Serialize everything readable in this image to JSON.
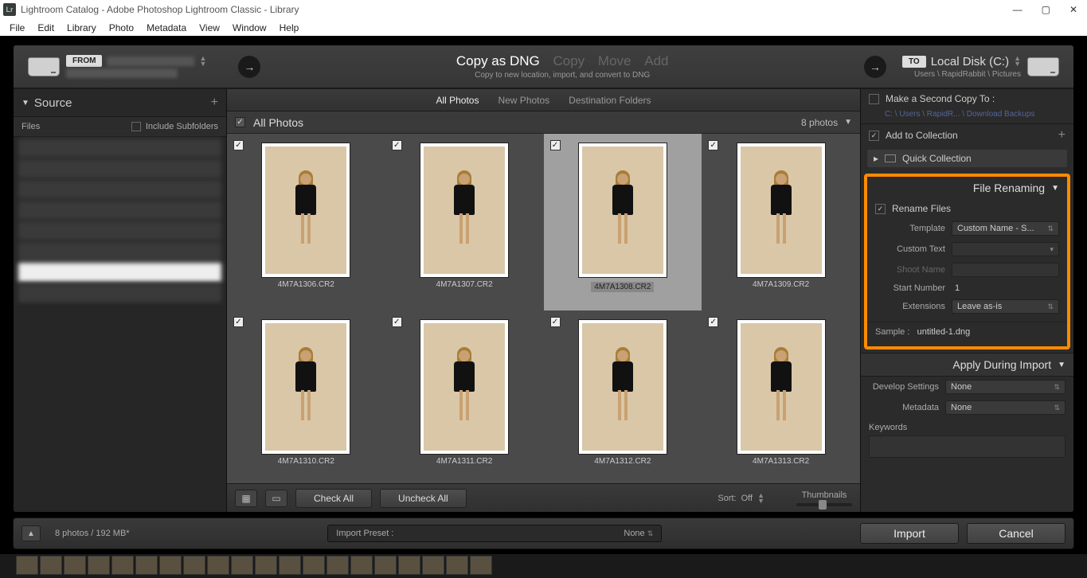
{
  "window": {
    "title": "Lightroom Catalog - Adobe Photoshop Lightroom Classic - Library",
    "logo": "Lr"
  },
  "menu": [
    "File",
    "Edit",
    "Library",
    "Photo",
    "Metadata",
    "View",
    "Window",
    "Help"
  ],
  "topbar": {
    "from_label": "FROM",
    "actions": {
      "copy_dng": "Copy as DNG",
      "copy": "Copy",
      "move": "Move",
      "add": "Add"
    },
    "subcaption": "Copy to new location, import, and convert to DNG",
    "to_label": "TO",
    "dest": "Local Disk (C:)",
    "dest_path": "Users \\ RapidRabbit \\ Pictures"
  },
  "left": {
    "source": "Source",
    "files": "Files",
    "include_subfolders": "Include Subfolders"
  },
  "tabs": {
    "all": "All Photos",
    "new": "New Photos",
    "dest": "Destination Folders"
  },
  "grid": {
    "title": "All Photos",
    "count": "8 photos",
    "items": [
      {
        "name": "4M7A1306.CR2"
      },
      {
        "name": "4M7A1307.CR2"
      },
      {
        "name": "4M7A1308.CR2"
      },
      {
        "name": "4M7A1309.CR2"
      },
      {
        "name": "4M7A1310.CR2"
      },
      {
        "name": "4M7A1311.CR2"
      },
      {
        "name": "4M7A1312.CR2"
      },
      {
        "name": "4M7A1313.CR2"
      }
    ],
    "check_all": "Check All",
    "uncheck_all": "Uncheck All",
    "sort_label": "Sort:",
    "sort_value": "Off",
    "thumbnails": "Thumbnails"
  },
  "right": {
    "second_copy": "Make a Second Copy To :",
    "second_copy_path": "C: \\ Users \\ RapidR... \\ Download Backups",
    "add_collection": "Add to Collection",
    "quick_collection": "Quick Collection",
    "file_renaming": "File Renaming",
    "rename_files": "Rename Files",
    "template_label": "Template",
    "template_value": "Custom Name - S...",
    "custom_text": "Custom Text",
    "shoot_name": "Shoot Name",
    "start_number_label": "Start Number",
    "start_number_value": "1",
    "extensions_label": "Extensions",
    "extensions_value": "Leave as-is",
    "sample_label": "Sample :",
    "sample_value": "untitled-1.dng",
    "apply_during": "Apply During Import",
    "develop_label": "Develop Settings",
    "develop_value": "None",
    "metadata_label": "Metadata",
    "metadata_value": "None",
    "keywords": "Keywords"
  },
  "footer": {
    "info": "8 photos / 192 MB*",
    "preset_label": "Import Preset :",
    "preset_value": "None",
    "import": "Import",
    "cancel": "Cancel"
  }
}
